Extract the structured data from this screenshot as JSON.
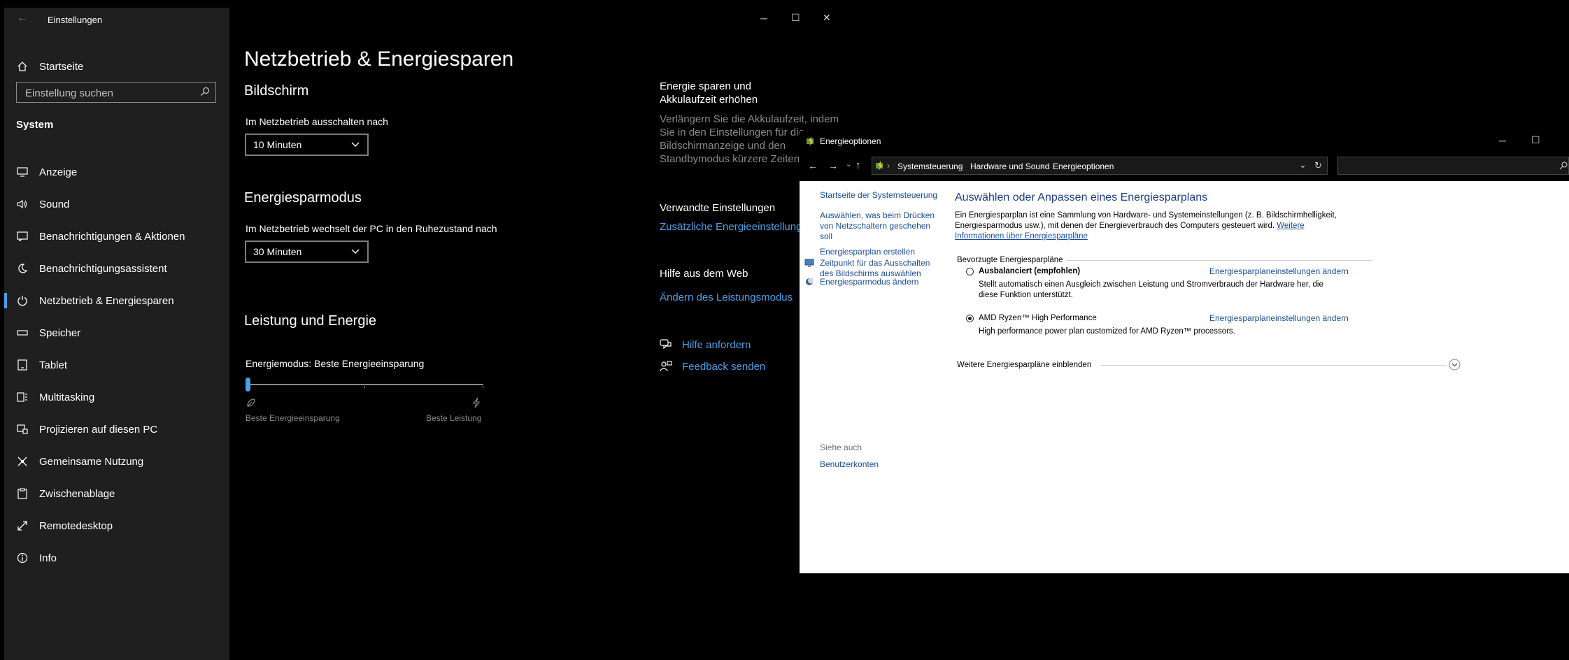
{
  "settings": {
    "window_title": "Einstellungen",
    "home": "Startseite",
    "search_placeholder": "Einstellung suchen",
    "section": "System",
    "nav": [
      {
        "label": "Anzeige",
        "icon": "display-icon"
      },
      {
        "label": "Sound",
        "icon": "speaker-icon"
      },
      {
        "label": "Benachrichtigungen & Aktionen",
        "icon": "notification-icon"
      },
      {
        "label": "Benachrichtigungsassistent",
        "icon": "moon-icon"
      },
      {
        "label": "Netzbetrieb & Energiesparen",
        "icon": "power-icon",
        "active": true
      },
      {
        "label": "Speicher",
        "icon": "storage-icon"
      },
      {
        "label": "Tablet",
        "icon": "tablet-icon"
      },
      {
        "label": "Multitasking",
        "icon": "multitasking-icon"
      },
      {
        "label": "Projizieren auf diesen PC",
        "icon": "project-icon"
      },
      {
        "label": "Gemeinsame Nutzung",
        "icon": "share-icon"
      },
      {
        "label": "Zwischenablage",
        "icon": "clipboard-icon"
      },
      {
        "label": "Remotedesktop",
        "icon": "remote-icon"
      },
      {
        "label": "Info",
        "icon": "info-icon"
      }
    ],
    "page_title": "Netzbetrieb & Energiesparen",
    "screen": {
      "heading": "Bildschirm",
      "label": "Im Netzbetrieb ausschalten nach",
      "value": "10 Minuten"
    },
    "sleep": {
      "heading": "Energiesparmodus",
      "label": "Im Netzbetrieb wechselt der PC in den Ruhezustand nach",
      "value": "30 Minuten"
    },
    "performance": {
      "heading": "Leistung und Energie",
      "mode_label": "Energiemodus: Beste Energieeinsparung",
      "slider_value": 0,
      "min_label": "Beste Energieeinsparung",
      "max_label": "Beste Leistung"
    },
    "side": {
      "save_title": "Energie sparen und Akkulaufzeit erhöhen",
      "save_text": [
        "Verlängern Sie die Akkulaufzeit, indem",
        "Sie in den Einstellungen für die",
        "Bildschirmanzeige und den",
        "Standbymodus kürzere Zeiten w"
      ],
      "related_title": "Verwandte Einstellungen",
      "related_link": "Zusätzliche Energieeinstellungen",
      "web_title": "Hilfe aus dem Web",
      "web_link": "Ändern des Leistungsmodus",
      "help_link": "Hilfe anfordern",
      "feedback_link": "Feedback senden"
    }
  },
  "cpl": {
    "window_title": "Energieoptionen",
    "breadcrumb": [
      "Systemsteuerung",
      "Hardware und Sound",
      "Energieoptionen"
    ],
    "left_links": [
      "Startseite der Systemsteuerung",
      "Auswählen, was beim Drücken von Netzschaltern geschehen soll",
      "Energiesparplan erstellen",
      "Zeitpunkt für das Ausschalten des Bildschirms auswählen",
      "Energiesparmodus ändern"
    ],
    "see_also": "Siehe auch",
    "user_accounts": "Benutzerkonten",
    "heading": "Auswählen oder Anpassen eines Energiesparplans",
    "intro_line1": "Ein Energiesparplan ist eine Sammlung von Hardware- und Systemeinstellungen (z. B. Bildschirmhelligkeit,",
    "intro_line2": "Energiesparmodus usw.), mit denen der Energieverbrauch des Computers gesteuert wird.",
    "intro_link1": "Weitere",
    "intro_link2": "Informationen über Energiesparpläne",
    "preferred_label": "Bevorzugte Energiesparpläne",
    "plans": [
      {
        "name": "Ausbalanciert (empfohlen)",
        "desc_line1": "Stellt automatisch einen Ausgleich zwischen Leistung und Stromverbrauch der Hardware her, die",
        "desc_line2": "diese Funktion unterstützt.",
        "link": "Energiesparplaneinstellungen ändern",
        "selected": false
      },
      {
        "name": "AMD Ryzen™ High Performance",
        "desc_line1": "High performance power plan customized for AMD Ryzen™ processors.",
        "desc_line2": "",
        "link": "Energiesparplaneinstellungen ändern",
        "selected": true
      }
    ],
    "more_plans": "Weitere Energiesparpläne einblenden"
  }
}
